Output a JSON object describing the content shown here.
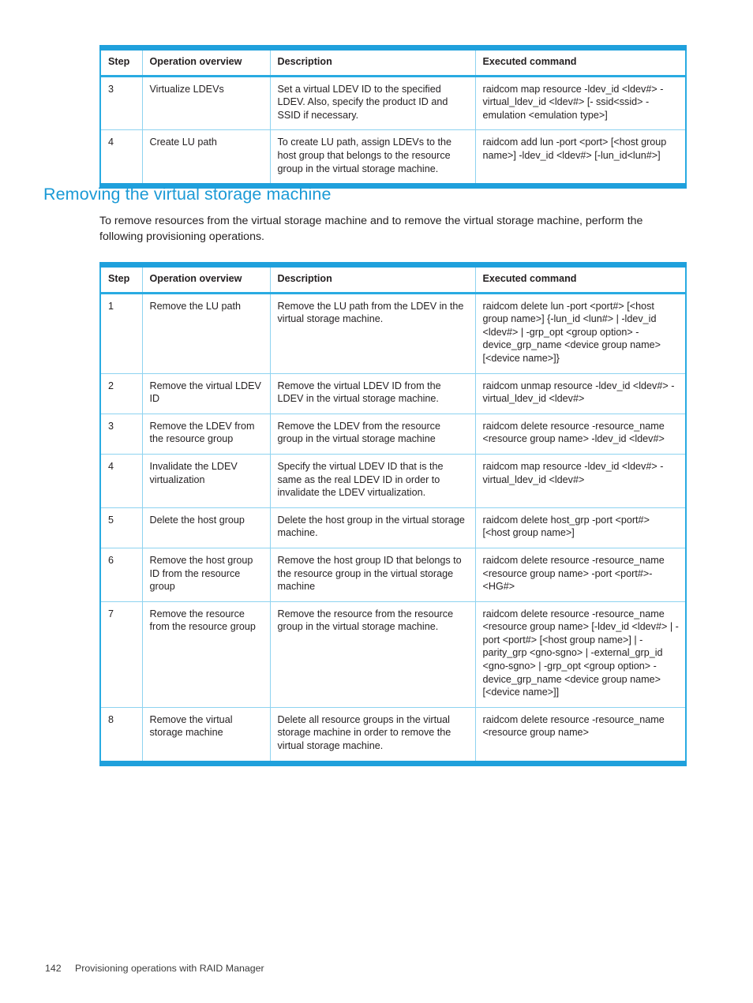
{
  "page": {
    "number": "142",
    "running_head": "Provisioning operations with RAID Manager",
    "accent_color": "#29ABE2",
    "heading_color": "#1B9AD6",
    "rule_color": "#8ED3F0"
  },
  "section": {
    "heading": "Removing the virtual storage machine",
    "paragraph": "To remove resources from the virtual storage machine and to remove the virtual storage machine, perform the following provisioning operations."
  },
  "table_virtualize": {
    "columns": [
      "Step",
      "Operation overview",
      "Description",
      "Executed command"
    ],
    "rows": [
      {
        "step": "3",
        "operation": "Virtualize LDEVs",
        "description": "Set a virtual LDEV ID to the specified LDEV. Also, specify the product ID and SSID if necessary.",
        "command": "raidcom map resource -ldev_id <ldev#> -virtual_ldev_id <ldev#> [- ssid<ssid> -emulation <emulation type>]"
      },
      {
        "step": "4",
        "operation": "Create LU path",
        "description": "To create LU path, assign LDEVs to the host group that belongs to the resource group in the virtual storage machine.",
        "command": "raidcom add lun -port <port> [<host group name>] -ldev_id <ldev#> [-lun_id<lun#>]"
      }
    ]
  },
  "table_removing": {
    "columns": [
      "Step",
      "Operation overview",
      "Description",
      "Executed command"
    ],
    "rows": [
      {
        "step": "1",
        "operation": "Remove the LU path",
        "description": "Remove the LU path from the LDEV in the virtual storage machine.",
        "command": "raidcom delete lun -port <port#> [<host group name>] {-lun_id <lun#> | -ldev_id <ldev#> | -grp_opt <group option> -device_grp_name <device group name> [<device name>]}"
      },
      {
        "step": "2",
        "operation": "Remove the virtual LDEV ID",
        "description": "Remove the virtual LDEV ID from the LDEV in the virtual storage machine.",
        "command": "raidcom unmap resource -ldev_id <ldev#> -virtual_ldev_id <ldev#>"
      },
      {
        "step": "3",
        "operation": "Remove the LDEV from the resource group",
        "description": "Remove the LDEV from the resource group in the virtual storage machine",
        "command": "raidcom delete resource -resource_name <resource group name> -ldev_id <ldev#>"
      },
      {
        "step": "4",
        "operation": "Invalidate the LDEV virtualization",
        "description": "Specify the virtual LDEV ID that is the same as the real LDEV ID in order to invalidate the LDEV virtualization.",
        "command": "raidcom map resource -ldev_id <ldev#> -virtual_ldev_id <ldev#>"
      },
      {
        "step": "5",
        "operation": "Delete the host group",
        "description": "Delete the host group in the virtual storage machine.",
        "command": "raidcom delete host_grp -port <port#> [<host group name>]"
      },
      {
        "step": "6",
        "operation": "Remove the host group ID from the resource group",
        "description": "Remove the host group ID that belongs to the resource group in the virtual storage machine",
        "command": "raidcom delete resource -resource_name <resource group name> -port <port#>-<HG#>"
      },
      {
        "step": "7",
        "operation": "Remove the resource from the resource group",
        "description": "Remove the resource from the resource group in the virtual storage machine.",
        "command": "raidcom delete resource -resource_name <resource group name> [-ldev_id <ldev#> | -port <port#> [<host group name>] | -parity_grp <gno-sgno> | -external_grp_id <gno-sgno> | -grp_opt <group option> -device_grp_name <device group name> [<device name>]]"
      },
      {
        "step": "8",
        "operation": "Remove the virtual storage machine",
        "description": "Delete all resource groups in the virtual storage machine in order to remove the virtual storage machine.",
        "command": "raidcom delete resource -resource_name <resource group name>"
      }
    ]
  }
}
